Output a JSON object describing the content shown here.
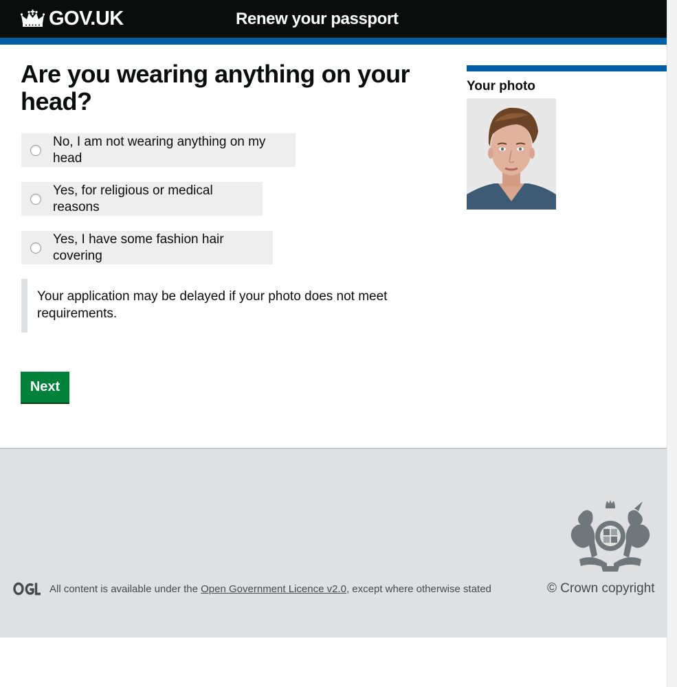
{
  "header": {
    "logo_text": "GOV.UK",
    "service_name": "Renew your passport"
  },
  "question": {
    "title": "Are you wearing anything on your head?",
    "options": [
      {
        "label": "No, I am not wearing anything on my head",
        "selected": false
      },
      {
        "label": "Yes, for religious or medical reasons",
        "selected": false
      },
      {
        "label": "Yes, I have some fashion hair covering",
        "selected": false
      }
    ],
    "notice": "Your application may be delayed if your photo does not meet requirements."
  },
  "actions": {
    "next_label": "Next"
  },
  "aside": {
    "title": "Your photo"
  },
  "footer": {
    "licence_prefix": "All content is available under the ",
    "licence_link": "Open Government Licence v2.0",
    "licence_suffix": ", except where otherwise stated",
    "copyright": "© Crown copyright"
  },
  "icons": {
    "logo": "crown-icon",
    "licence": "ogl-logo",
    "crest": "royal-coat-of-arms"
  },
  "colors": {
    "header_bg": "#0b0c0c",
    "accent_blue": "#005ea5",
    "button_green": "#00823b",
    "footer_bg": "#dee0e2",
    "option_bg": "#eeeeee"
  }
}
